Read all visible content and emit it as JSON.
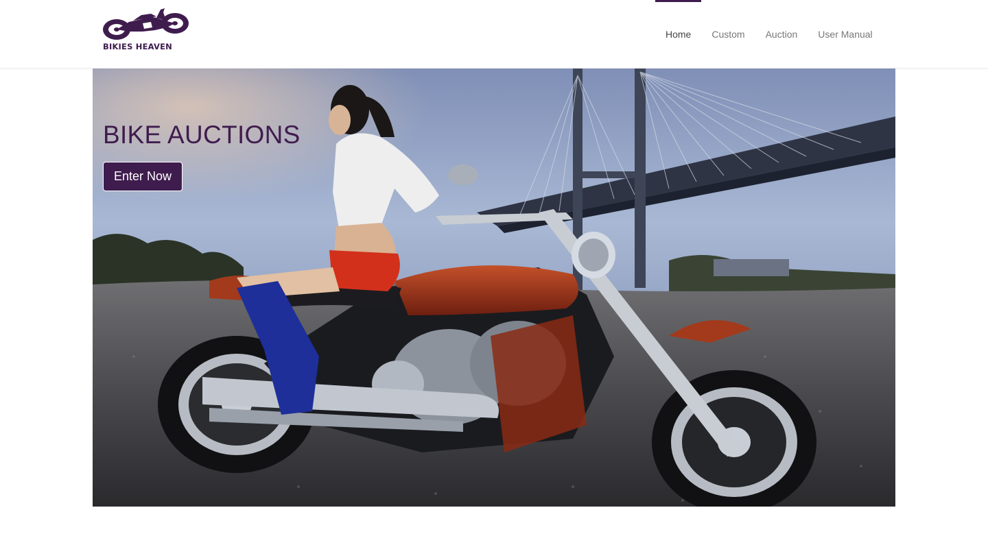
{
  "brand": {
    "name": "BIKIES HEAVEN",
    "logo_icon": "motorcycle-logo-icon",
    "color": "#3f1c4e"
  },
  "nav": {
    "items": [
      {
        "label": "Home",
        "active": true
      },
      {
        "label": "Custom",
        "active": false
      },
      {
        "label": "Auction",
        "active": false
      },
      {
        "label": "User Manual",
        "active": false
      }
    ]
  },
  "hero": {
    "title": "BIKE AUCTIONS",
    "button_label": "Enter Now",
    "image": "woman seated on red cruiser motorcycle under a cable-stayed bridge"
  },
  "colors": {
    "accent": "#3f1c4e",
    "nav_text": "#777777",
    "nav_text_active": "#444444"
  }
}
